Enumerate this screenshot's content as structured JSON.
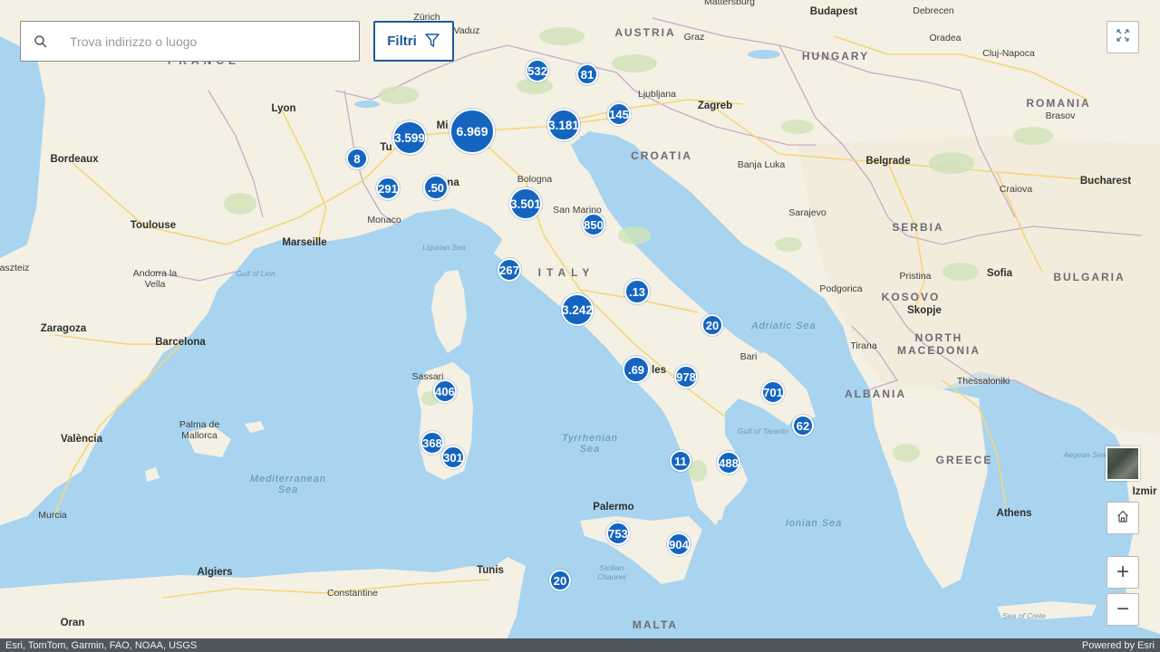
{
  "search": {
    "placeholder": "Trova indirizzo o luogo"
  },
  "filter": {
    "label": "Filtri"
  },
  "attribution": {
    "left": "Esri, TomTom, Garmin, FAO, NOAA, USGS",
    "right": "Powered by Esri"
  },
  "colors": {
    "cluster_fill": "#1565c0",
    "cluster_border": "#ffffff",
    "sea": "#a8d4ef",
    "land": "#f3efe6",
    "filter_accent": "#1a5a9a"
  },
  "icons": {
    "search": "search-icon",
    "filter": "filter-funnel-icon",
    "expand": "expand-arrows-icon",
    "home": "home-icon",
    "zoom_in": "plus-icon",
    "zoom_out": "minus-icon",
    "basemap": "basemap-thumbnail-icon"
  },
  "zoom_controls": {
    "zoom_in": "+",
    "zoom_out": "−"
  },
  "clusters": [
    {
      "label": "532"
    },
    {
      "label": "81"
    },
    {
      "label": "3.599"
    },
    {
      "label": "6.969"
    },
    {
      "label": "3.181"
    },
    {
      "label": "145"
    },
    {
      "label": "8"
    },
    {
      "label": "291"
    },
    {
      "label": ".50"
    },
    {
      "label": "3.501"
    },
    {
      "label": "850"
    },
    {
      "label": "267"
    },
    {
      "label": ".13"
    },
    {
      "label": "3.242"
    },
    {
      "label": "20"
    },
    {
      "label": ".69"
    },
    {
      "label": "978"
    },
    {
      "label": "406"
    },
    {
      "label": "701"
    },
    {
      "label": "62"
    },
    {
      "label": "368"
    },
    {
      "label": "301"
    },
    {
      "label": "11"
    },
    {
      "label": "488"
    },
    {
      "label": "753"
    },
    {
      "label": "904"
    },
    {
      "label": "20"
    }
  ],
  "places": {
    "cities": [
      "Zürich",
      "Vaduz",
      "Budapest",
      "Debrecen",
      "Graz",
      "Oradea",
      "Cluj-Napoca",
      "Ljubljana",
      "Zagreb",
      "Lyon",
      "Bordeaux",
      "Brasov",
      "Banja Luka",
      "Belgrade",
      "Bologna",
      "San Marino",
      "Craiova",
      "Bucharest",
      "Toulouse",
      "Monaco",
      "Marseille",
      "Sarajevo",
      "Andorra la Vella",
      "Pristina",
      "Sofia",
      "Podgorica",
      "Skopje",
      "Zaragoza",
      "Barcelona",
      "Tirana",
      "Bari",
      "Sassari",
      "Thessaloniki",
      "Palma de Mallorca",
      "València",
      "Palermo",
      "Murcia",
      "Athens",
      "Algiers",
      "Tunis",
      "Constantine",
      "Oran",
      "Mattersburg",
      "Izmir",
      "Mi",
      "Tu",
      "na",
      "les",
      "aszteiz"
    ],
    "countries": [
      "AUSTRIA",
      "HUNGARY",
      "ROMANIA",
      "CROATIA",
      "SERBIA",
      "BULGARIA",
      "ITALY",
      "KOSOVO",
      "NORTH MACEDONIA",
      "ALBANIA",
      "GREECE",
      "MALTA",
      "FRANCE"
    ],
    "seas": [
      "Ligurian Sea",
      "Gulf of Lion",
      "Adriatic Sea",
      "Tyrrhenian Sea",
      "Mediterranean Sea",
      "Ionian Sea",
      "Sicilian Channel",
      "Gulf of Taranto",
      "Aegean Sea",
      "Sea of Crete"
    ]
  }
}
